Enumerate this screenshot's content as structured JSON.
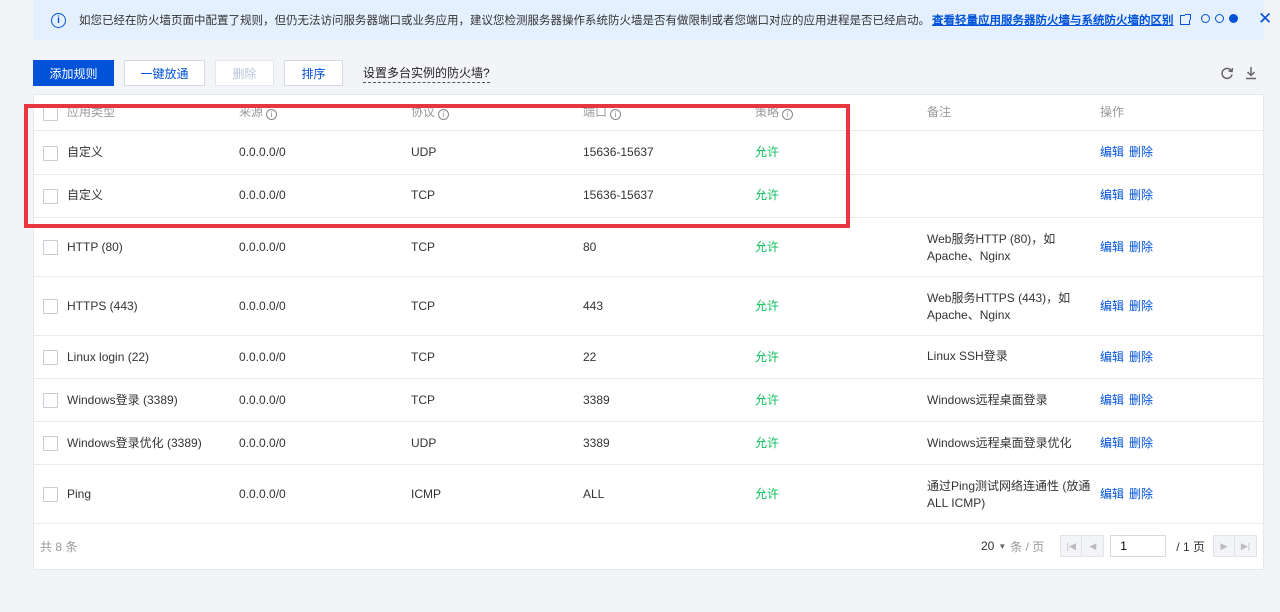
{
  "notice": {
    "message": "如您已经在防火墙页面中配置了规则，但仍无法访问服务器端口或业务应用，建议您检测服务器操作系统防火墙是否有做限制或者您端口对应的应用进程是否已经启动。",
    "link": "查看轻量应用服务器防火墙与系统防火墙的区别",
    "info_icon": "i",
    "close_icon": "✕"
  },
  "toolbar": {
    "add_rule": "添加规则",
    "one_click_allow": "一键放通",
    "delete": "删除",
    "sort": "排序",
    "multi_instance": "设置多台实例的防火墙?"
  },
  "table": {
    "headers": {
      "app_type": "应用类型",
      "source": "来源",
      "protocol": "协议",
      "port": "端口",
      "policy": "策略",
      "remark": "备注",
      "action": "操作"
    },
    "rows": [
      {
        "app_type": "自定义",
        "source": "0.0.0.0/0",
        "protocol": "UDP",
        "port": "15636-15637",
        "policy": "允许",
        "remark": "",
        "remark2": ""
      },
      {
        "app_type": "自定义",
        "source": "0.0.0.0/0",
        "protocol": "TCP",
        "port": "15636-15637",
        "policy": "允许",
        "remark": "",
        "remark2": ""
      },
      {
        "app_type": "HTTP (80)",
        "source": "0.0.0.0/0",
        "protocol": "TCP",
        "port": "80",
        "policy": "允许",
        "remark": "Web服务HTTP (80)，如",
        "remark2": "Apache、Nginx"
      },
      {
        "app_type": "HTTPS (443)",
        "source": "0.0.0.0/0",
        "protocol": "TCP",
        "port": "443",
        "policy": "允许",
        "remark": "Web服务HTTPS (443)，如",
        "remark2": "Apache、Nginx"
      },
      {
        "app_type": "Linux login (22)",
        "source": "0.0.0.0/0",
        "protocol": "TCP",
        "port": "22",
        "policy": "允许",
        "remark": "Linux SSH登录",
        "remark2": ""
      },
      {
        "app_type": "Windows登录 (3389)",
        "source": "0.0.0.0/0",
        "protocol": "TCP",
        "port": "3389",
        "policy": "允许",
        "remark": "Windows远程桌面登录",
        "remark2": ""
      },
      {
        "app_type": "Windows登录优化 (3389)",
        "source": "0.0.0.0/0",
        "protocol": "UDP",
        "port": "3389",
        "policy": "允许",
        "remark": "Windows远程桌面登录优化",
        "remark2": ""
      },
      {
        "app_type": "Ping",
        "source": "0.0.0.0/0",
        "protocol": "ICMP",
        "port": "ALL",
        "policy": "允许",
        "remark": "通过Ping测试网络连通性 (放通",
        "remark2": "ALL ICMP)"
      }
    ],
    "edit_label": "编辑",
    "delete_label": "删除"
  },
  "footer": {
    "total": "共 8 条",
    "page_size": "20",
    "page_unit": "条 / 页",
    "current_page": "1",
    "total_pages": "/ 1 页"
  },
  "colors": {
    "accent": "#0052d9",
    "allow": "#0abf5b",
    "highlight": "#e8363f"
  }
}
